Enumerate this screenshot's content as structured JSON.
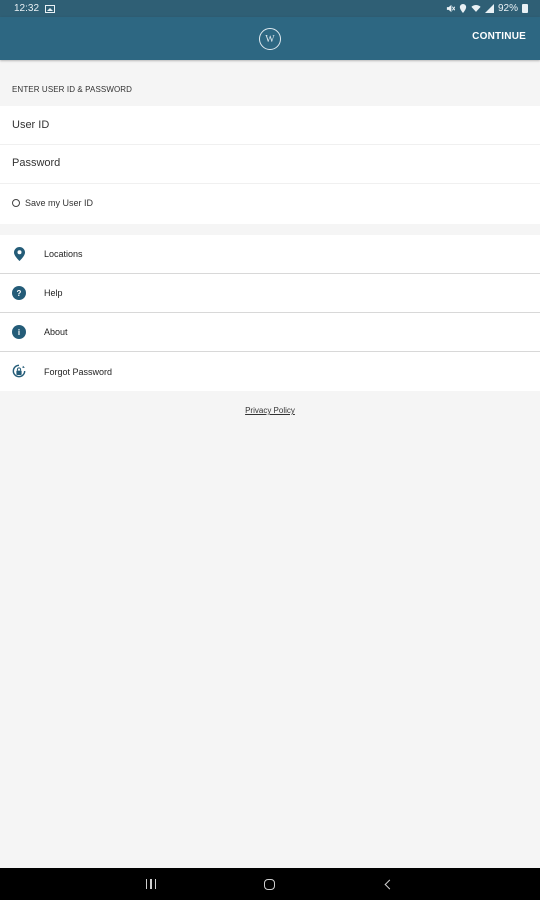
{
  "status_bar": {
    "time": "12:32",
    "battery": "92%",
    "icons": [
      "image-icon",
      "mute-icon",
      "location-icon",
      "wifi-icon",
      "signal-icon",
      "battery-icon"
    ]
  },
  "app_bar": {
    "logo_letter": "W",
    "continue_label": "CONTINUE"
  },
  "login": {
    "section_label": "ENTER USER ID & PASSWORD",
    "user_id_placeholder": "User ID",
    "password_placeholder": "Password",
    "save_label": "Save my User ID",
    "save_checked": false
  },
  "menu": {
    "items": [
      {
        "label": "Locations",
        "icon": "location-pin-icon"
      },
      {
        "label": "Help",
        "icon": "help-icon"
      },
      {
        "label": "About",
        "icon": "info-icon"
      },
      {
        "label": "Forgot Password",
        "icon": "lock-reset-icon"
      }
    ]
  },
  "footer": {
    "privacy_label": "Privacy Policy"
  },
  "colors": {
    "status_bar": "#2f5f75",
    "app_bar": "#2d6782",
    "icon_accent": "#245c78",
    "background": "#f5f5f5"
  }
}
